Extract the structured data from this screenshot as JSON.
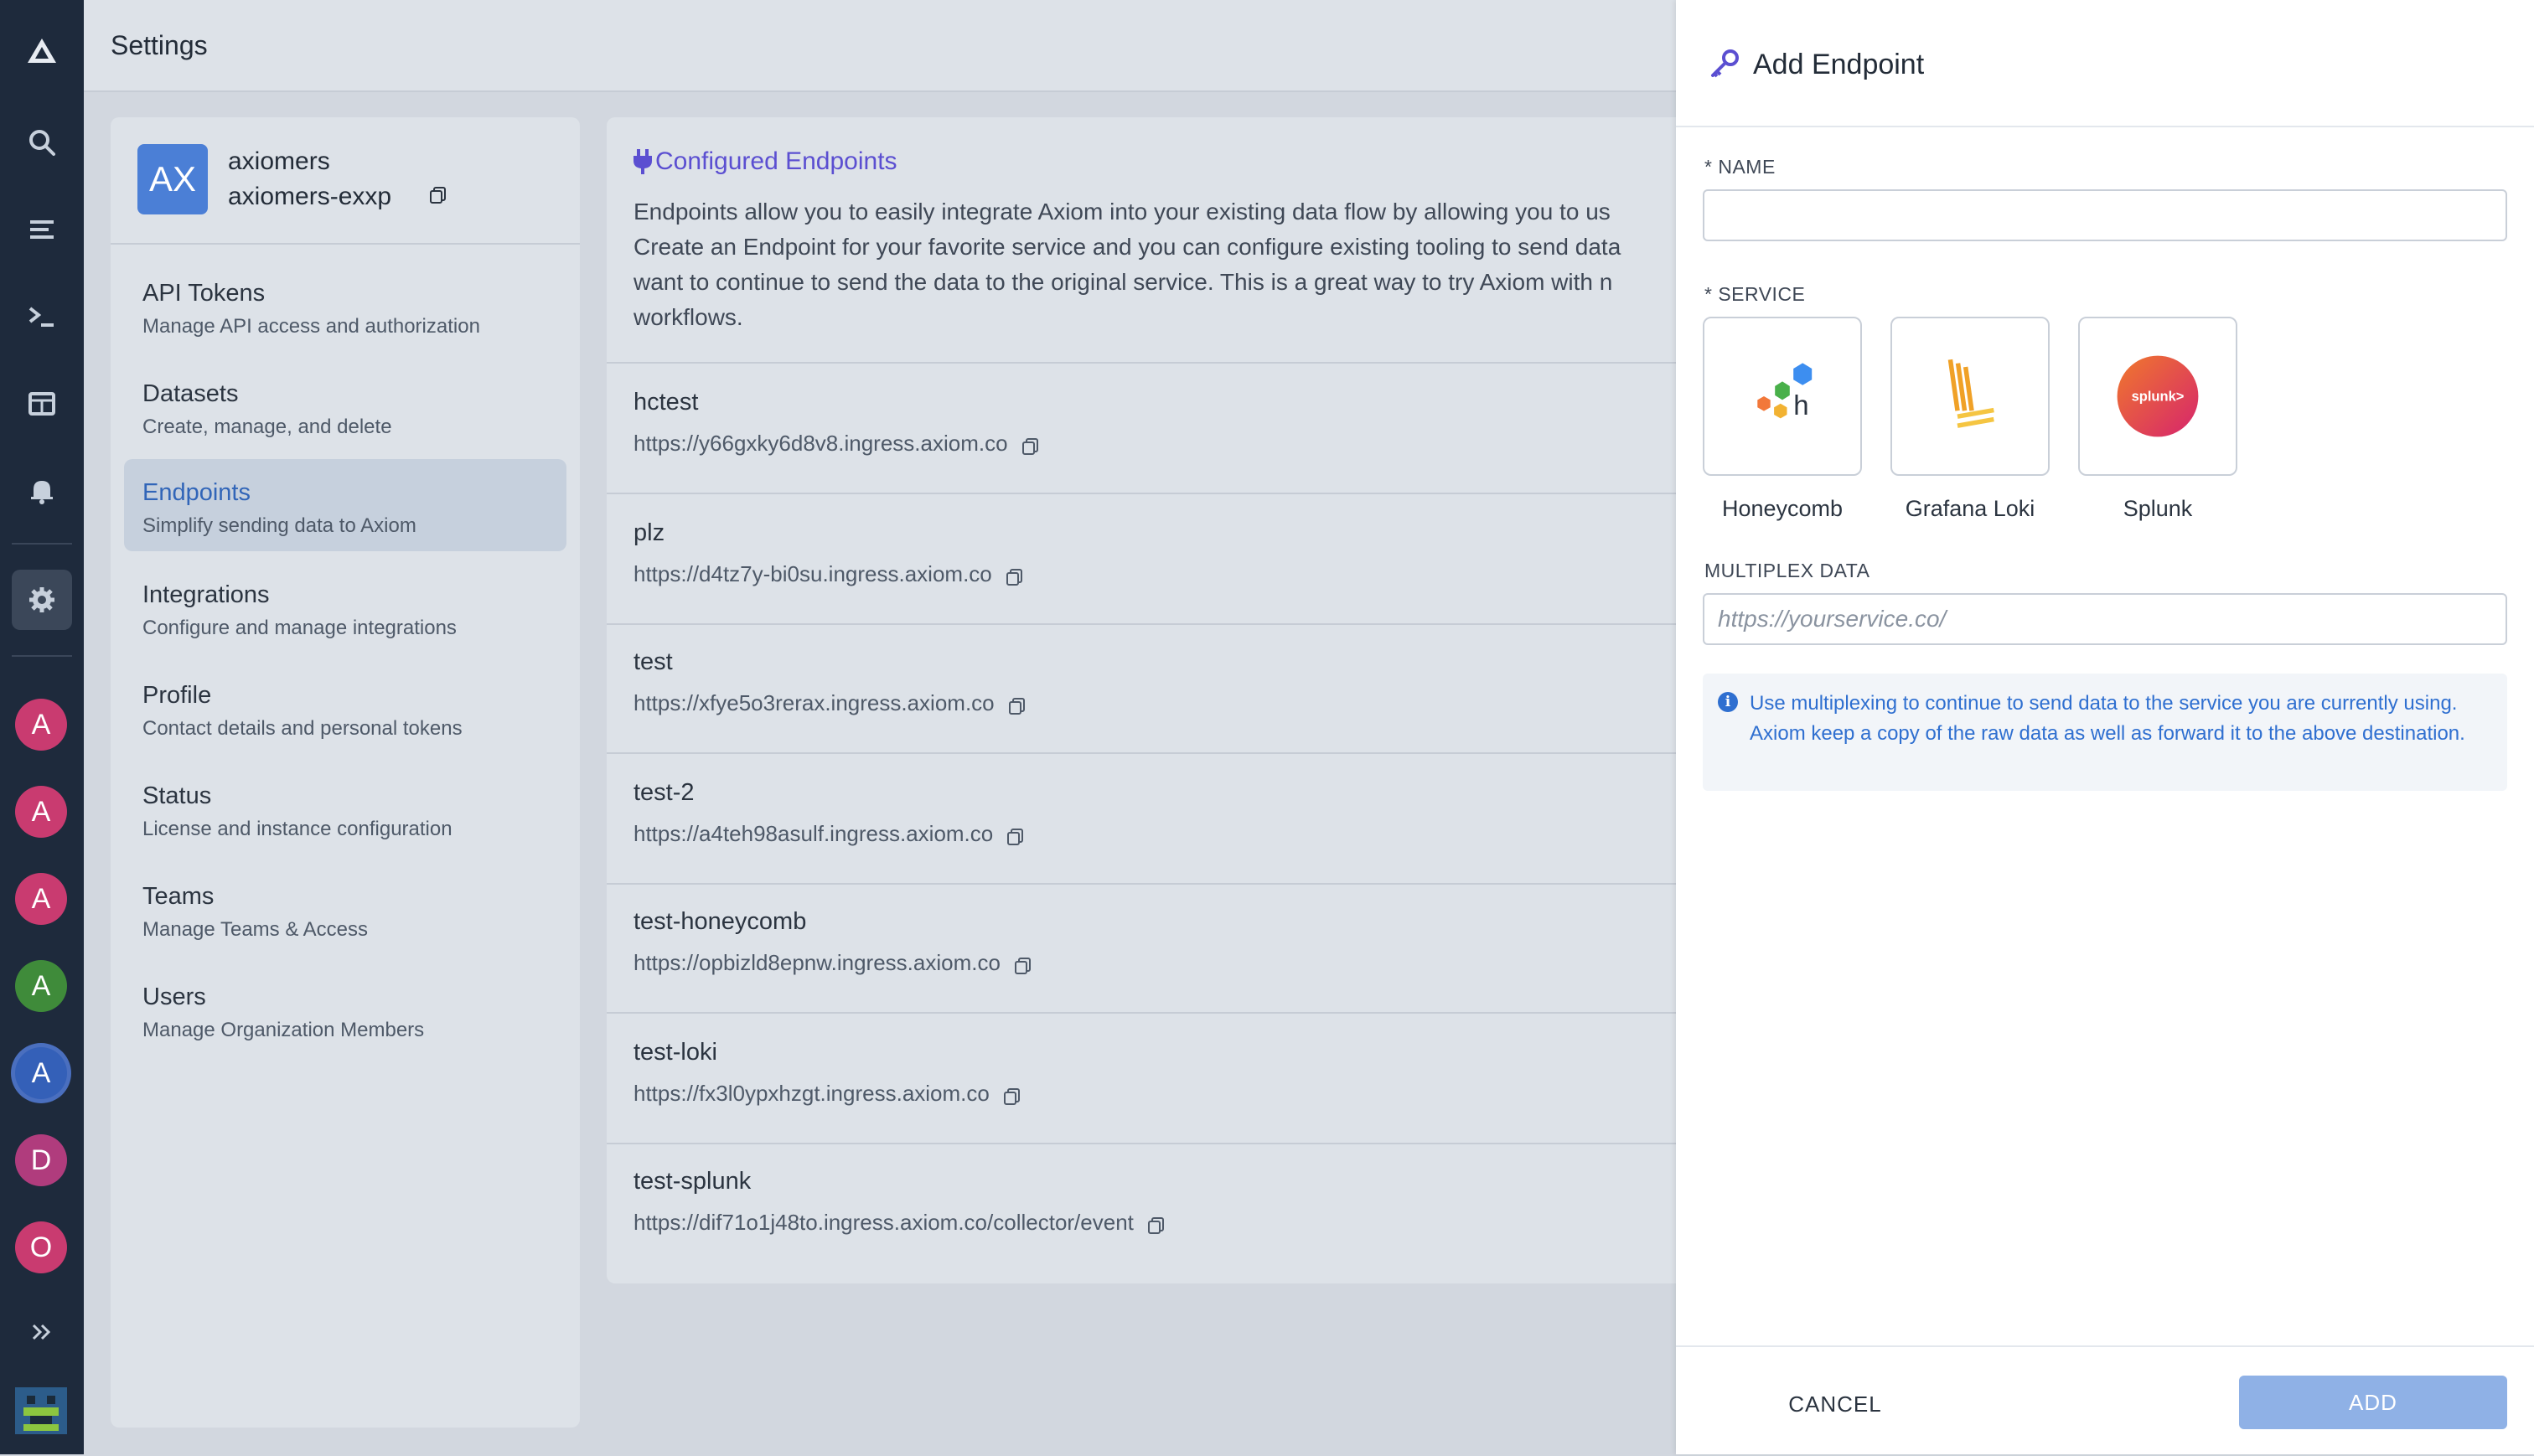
{
  "rail": {
    "icons": [
      "axiom-logo-icon",
      "search-icon",
      "stream-icon",
      "terminal-icon",
      "dashboard-icon",
      "bell-icon",
      "gear-icon"
    ],
    "orgs": [
      {
        "letter": "A",
        "color": "#c93b70"
      },
      {
        "letter": "A",
        "color": "#c93b70"
      },
      {
        "letter": "A",
        "color": "#c93b70"
      },
      {
        "letter": "A",
        "color": "#3f8b3a"
      },
      {
        "letter": "A",
        "color": "#3460b8",
        "selected": true
      },
      {
        "letter": "D",
        "color": "#b03c7d"
      },
      {
        "letter": "O",
        "color": "#c93b70"
      }
    ],
    "expand_icon": "double-chevron-right-icon"
  },
  "page": {
    "title": "Settings"
  },
  "org": {
    "badge": "AX",
    "name": "axiomers",
    "id": "axiomers-exxp"
  },
  "settings_nav": [
    {
      "label": "API Tokens",
      "desc": "Manage API access and authorization"
    },
    {
      "label": "Datasets",
      "desc": "Create, manage, and delete"
    },
    {
      "label": "Endpoints",
      "desc": "Simplify sending data to Axiom",
      "active": true
    },
    {
      "label": "Integrations",
      "desc": "Configure and manage integrations"
    },
    {
      "label": "Profile",
      "desc": "Contact details and personal tokens"
    },
    {
      "label": "Status",
      "desc": "License and instance configuration"
    },
    {
      "label": "Teams",
      "desc": "Manage Teams & Access"
    },
    {
      "label": "Users",
      "desc": "Manage Organization Members"
    }
  ],
  "endpoints": {
    "title": "Configured Endpoints",
    "description": "Endpoints allow you to easily integrate Axiom into your existing data flow by allowing you to us\nCreate an Endpoint for your favorite service and you can configure existing tooling to send data\nwant to continue to send the data to the original service. This is a great way to try Axiom with n\nworkflows.",
    "items": [
      {
        "name": "hctest",
        "url": "https://y66gxky6d8v8.ingress.axiom.co"
      },
      {
        "name": "plz",
        "url": "https://d4tz7y-bi0su.ingress.axiom.co"
      },
      {
        "name": "test",
        "url": "https://xfye5o3rerax.ingress.axiom.co"
      },
      {
        "name": "test-2",
        "url": "https://a4teh98asulf.ingress.axiom.co"
      },
      {
        "name": "test-honeycomb",
        "url": "https://opbizld8epnw.ingress.axiom.co"
      },
      {
        "name": "test-loki",
        "url": "https://fx3l0ypxhzgt.ingress.axiom.co"
      },
      {
        "name": "test-splunk",
        "url": "https://dif71o1j48to.ingress.axiom.co/collector/event"
      }
    ]
  },
  "drawer": {
    "title": "Add Endpoint",
    "name_label": "* NAME",
    "name_value": "",
    "service_label": "* SERVICE",
    "services": [
      {
        "label": "Honeycomb",
        "icon": "honeycomb-logo-icon"
      },
      {
        "label": "Grafana Loki",
        "icon": "grafana-loki-logo-icon"
      },
      {
        "label": "Splunk",
        "icon": "splunk-logo-icon",
        "logo_text": "splunk>"
      }
    ],
    "multiplex_label": "MULTIPLEX DATA",
    "multiplex_placeholder": "https://yourservice.co/",
    "info_text": "Use multiplexing to continue to send data to the service you are currently using. Axiom keep a copy of the raw data as well as forward it to the above destination.",
    "cancel_label": "CANCEL",
    "add_label": "ADD"
  },
  "colors": {
    "accent": "#5b4fd1",
    "link": "#3165b8",
    "info": "#2f6fd0",
    "add_button": "#8fb1e6",
    "splunk_gradient": [
      "#f0792c",
      "#d6246d"
    ]
  }
}
